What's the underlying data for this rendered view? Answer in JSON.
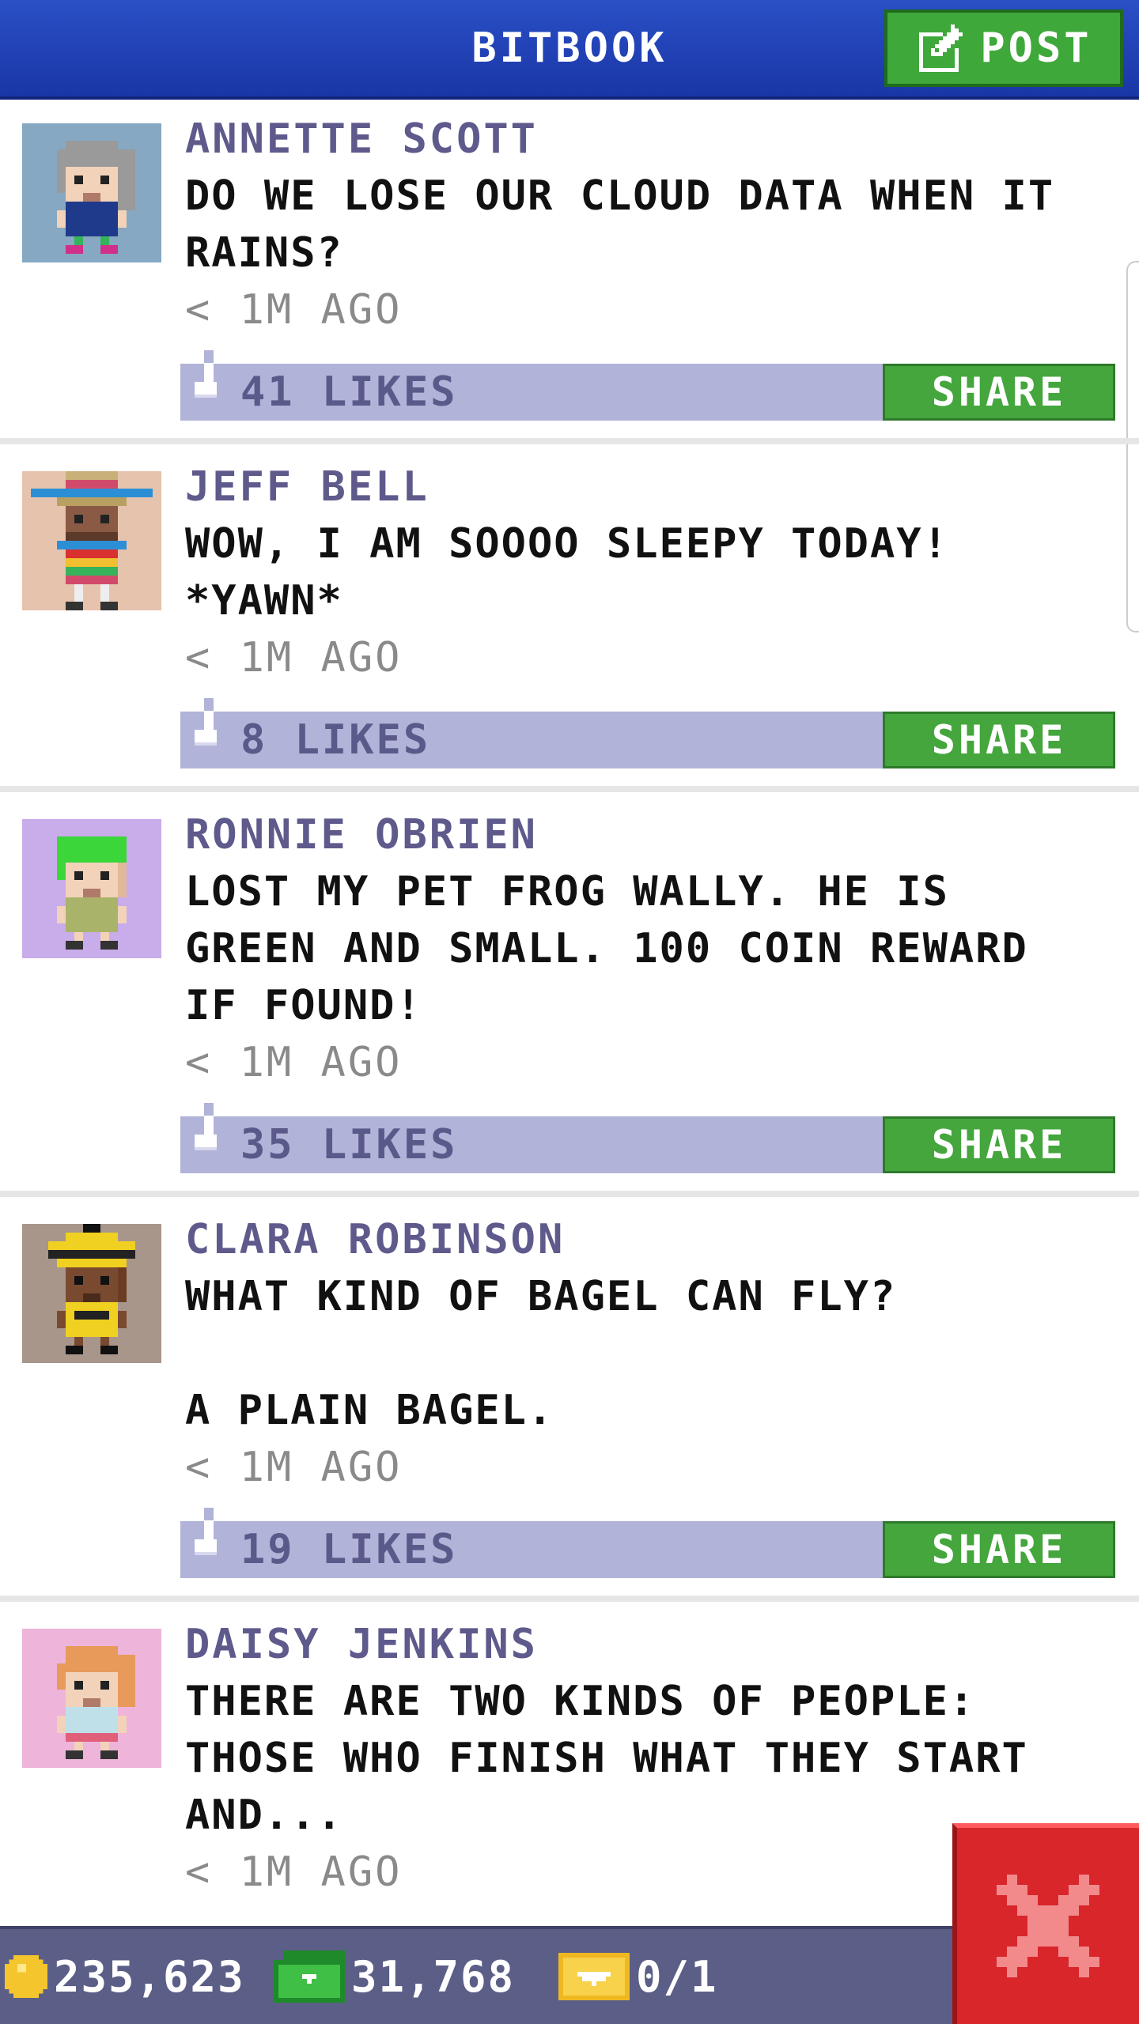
{
  "header": {
    "title": "BITBOOK",
    "post_label": "POST"
  },
  "posts": [
    {
      "author": "ANNETTE SCOTT",
      "text": "DO WE LOSE OUR CLOUD DATA WHEN IT RAINS?",
      "time": "< 1M AGO",
      "likes": "41 LIKES",
      "share": "SHARE",
      "avatar_bg": "#86a8c2"
    },
    {
      "author": "JEFF BELL",
      "text": "WOW, I AM SOOOO SLEEPY TODAY! *YAWN*",
      "time": "< 1M AGO",
      "likes": "8 LIKES",
      "share": "SHARE",
      "avatar_bg": "#e6c3ad"
    },
    {
      "author": "RONNIE OBRIEN",
      "text": "LOST MY PET FROG WALLY. HE IS GREEN AND SMALL. 100 COIN REWARD IF FOUND!",
      "time": "< 1M AGO",
      "likes": "35 LIKES",
      "share": "SHARE",
      "avatar_bg": "#c9acea"
    },
    {
      "author": "CLARA ROBINSON",
      "text": "WHAT KIND OF BAGEL CAN FLY?\n\nA PLAIN BAGEL.",
      "time": "< 1M AGO",
      "likes": "19 LIKES",
      "share": "SHARE",
      "avatar_bg": "#a8968a"
    },
    {
      "author": "DAISY JENKINS",
      "text": "THERE ARE TWO KINDS OF PEOPLE: THOSE WHO FINISH WHAT THEY START AND...",
      "time": "< 1M AGO",
      "avatar_bg": "#eeb4da"
    }
  ],
  "status": {
    "coins": "235,623",
    "bux": "31,768",
    "tickets": "0/1"
  },
  "colors": {
    "header_blue": "#1f3fb5",
    "post_green": "#3fa83a",
    "likes_bar": "#b1b3d8",
    "author": "#5e5a8c",
    "status_bar": "#5b5f87",
    "close_red": "#d8262b"
  },
  "icons": {
    "post": "edit-icon",
    "like": "thumbs-up-icon",
    "coin": "coin-icon",
    "bux": "bux-icon",
    "ticket": "ticket-icon",
    "close": "close-icon"
  }
}
